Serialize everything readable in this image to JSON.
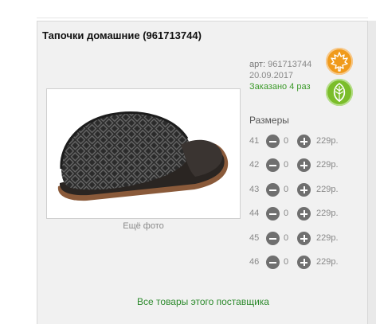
{
  "product": {
    "title": "Тапочки домашние (961713744)",
    "more_photos": "Ещё фото",
    "article_label": "арт:",
    "article": "961713744",
    "date": "20.09.2017",
    "ordered": "Заказано 4 раз"
  },
  "badges": [
    {
      "name": "maple-leaf-icon",
      "color": "#f09a1b"
    },
    {
      "name": "leaf-icon",
      "color": "#7bbd2a"
    }
  ],
  "sizes": {
    "title": "Размеры",
    "rows": [
      {
        "size": "41",
        "qty": "0",
        "price": "229р."
      },
      {
        "size": "42",
        "qty": "0",
        "price": "229р."
      },
      {
        "size": "43",
        "qty": "0",
        "price": "229р."
      },
      {
        "size": "44",
        "qty": "0",
        "price": "229р."
      },
      {
        "size": "45",
        "qty": "0",
        "price": "229р."
      },
      {
        "size": "46",
        "qty": "0",
        "price": "229р."
      }
    ]
  },
  "supplier_link": "Все товары этого поставщика",
  "colors": {
    "accent_green": "#2e8b2e",
    "card_bg": "#f1f1f1"
  }
}
